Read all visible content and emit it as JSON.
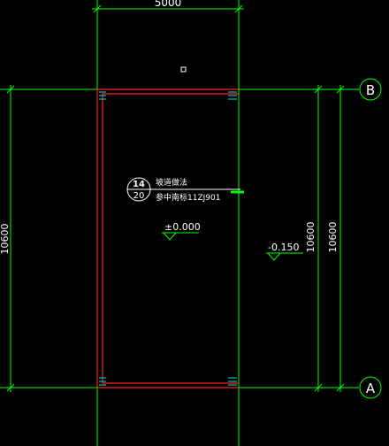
{
  "drawing": {
    "colors": {
      "background": "#000000",
      "grid_line": "#00ff00",
      "wall": "#ff2020",
      "column_marks": "#00e0e0",
      "text": "#ffffff",
      "dim_text": "#ffffff"
    },
    "dimensions": {
      "top_width": "5000",
      "left_height": "10600",
      "right_inner_height": "10600",
      "right_outer_height": "10600"
    },
    "axes": {
      "axis_b": "B",
      "axis_a": "A"
    },
    "detail_callout": {
      "number": "14",
      "sheet": "20",
      "title": "坡道做法",
      "reference": "参中南标11ZJ901"
    },
    "elevations": {
      "floor": "±0.000",
      "outside": "-0.150"
    }
  }
}
